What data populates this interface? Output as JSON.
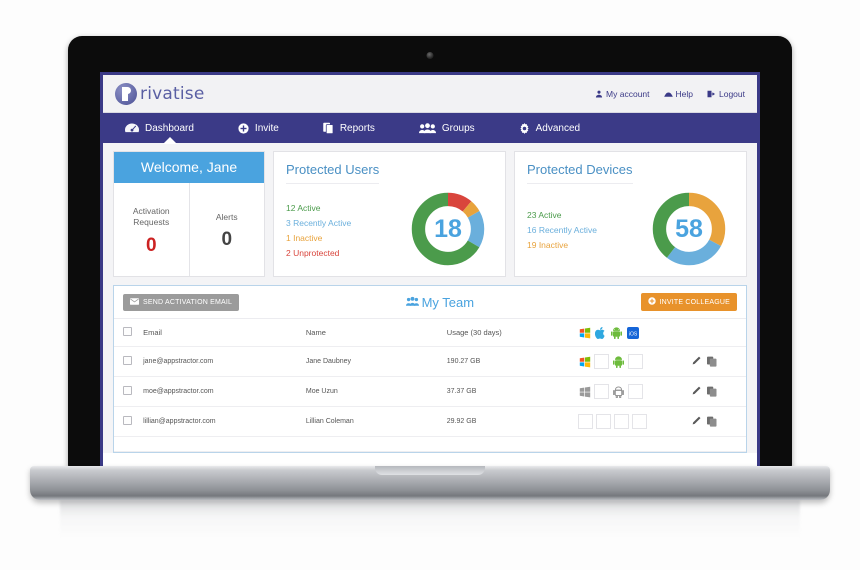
{
  "app": {
    "brand_name": "rivatise",
    "brand_mark_icon": "privatise-logo-icon"
  },
  "header": {
    "links": [
      {
        "label": "My account",
        "icon": "user-icon"
      },
      {
        "label": "Help",
        "icon": "help-icon"
      },
      {
        "label": "Logout",
        "icon": "logout-icon"
      }
    ]
  },
  "nav": {
    "items": [
      {
        "label": "Dashboard",
        "icon": "gauge-icon",
        "active": true
      },
      {
        "label": "Invite",
        "icon": "plus-circle-icon",
        "active": false
      },
      {
        "label": "Reports",
        "icon": "reports-icon",
        "active": false
      },
      {
        "label": "Groups",
        "icon": "groups-icon",
        "active": false
      },
      {
        "label": "Advanced",
        "icon": "gear-icon",
        "active": false
      }
    ]
  },
  "welcome_card": {
    "banner": "Welcome, Jane",
    "stats": [
      {
        "label": "Activation Requests",
        "value": "0",
        "color": "#cc2222"
      },
      {
        "label": "Alerts",
        "value": "0",
        "color": "#444444"
      }
    ]
  },
  "protected_users": {
    "title": "Protected Users",
    "total": "18",
    "legend": [
      {
        "label": "12 Active",
        "color": "#4b9b4b"
      },
      {
        "label": "3 Recently Active",
        "color": "#6aafdc"
      },
      {
        "label": "1 Inactive",
        "color": "#e8a33d"
      },
      {
        "label": "2 Unprotected",
        "color": "#d9453c"
      }
    ]
  },
  "protected_devices": {
    "title": "Protected Devices",
    "total": "58",
    "legend": [
      {
        "label": "23 Active",
        "color": "#4b9b4b"
      },
      {
        "label": "16 Recently Active",
        "color": "#6aafdc"
      },
      {
        "label": "19 Inactive",
        "color": "#e8a33d"
      }
    ]
  },
  "chart_data": [
    {
      "type": "pie",
      "title": "Protected Users",
      "categories": [
        "Active",
        "Recently Active",
        "Inactive",
        "Unprotected"
      ],
      "values": [
        12,
        3,
        1,
        2
      ],
      "colors": [
        "#4b9b4b",
        "#6aafdc",
        "#e8a33d",
        "#d9453c"
      ],
      "center_label": "18",
      "legend": "left",
      "donut": true
    },
    {
      "type": "pie",
      "title": "Protected Devices",
      "categories": [
        "Active",
        "Recently Active",
        "Inactive"
      ],
      "values": [
        23,
        16,
        19
      ],
      "colors": [
        "#4b9b4b",
        "#6aafdc",
        "#e8a33d"
      ],
      "center_label": "58",
      "legend": "left",
      "donut": true
    }
  ],
  "team": {
    "heading": "My Team",
    "heading_icon": "group-icon",
    "send_activation_label": "SEND ACTIVATION EMAIL",
    "send_activation_icon": "envelope-icon",
    "invite_label": "INVITE COLLEAGUE",
    "invite_icon": "plus-circle-icon",
    "columns": {
      "email": "Email",
      "name": "Name",
      "usage": "Usage (30 days)"
    },
    "platform_icons": [
      "windows-icon",
      "apple-icon",
      "android-icon",
      "ios-icon"
    ],
    "rows": [
      {
        "email": "jane@appstractor.com",
        "name": "Jane Daubney",
        "usage": "190.27 GB",
        "platforms": [
          "windows-active",
          "empty",
          "android-active",
          "empty"
        ]
      },
      {
        "email": "moe@appstractor.com",
        "name": "Moe Uzun",
        "usage": "37.37 GB",
        "platforms": [
          "windows-grey",
          "empty",
          "android-grey",
          "empty"
        ]
      },
      {
        "email": "lillian@appstractor.com",
        "name": "Lillian Coleman",
        "usage": "29.92 GB",
        "platforms": [
          "empty",
          "empty",
          "empty",
          "empty"
        ]
      }
    ],
    "row_actions": [
      "edit-pencil-icon",
      "copy-icon"
    ]
  }
}
